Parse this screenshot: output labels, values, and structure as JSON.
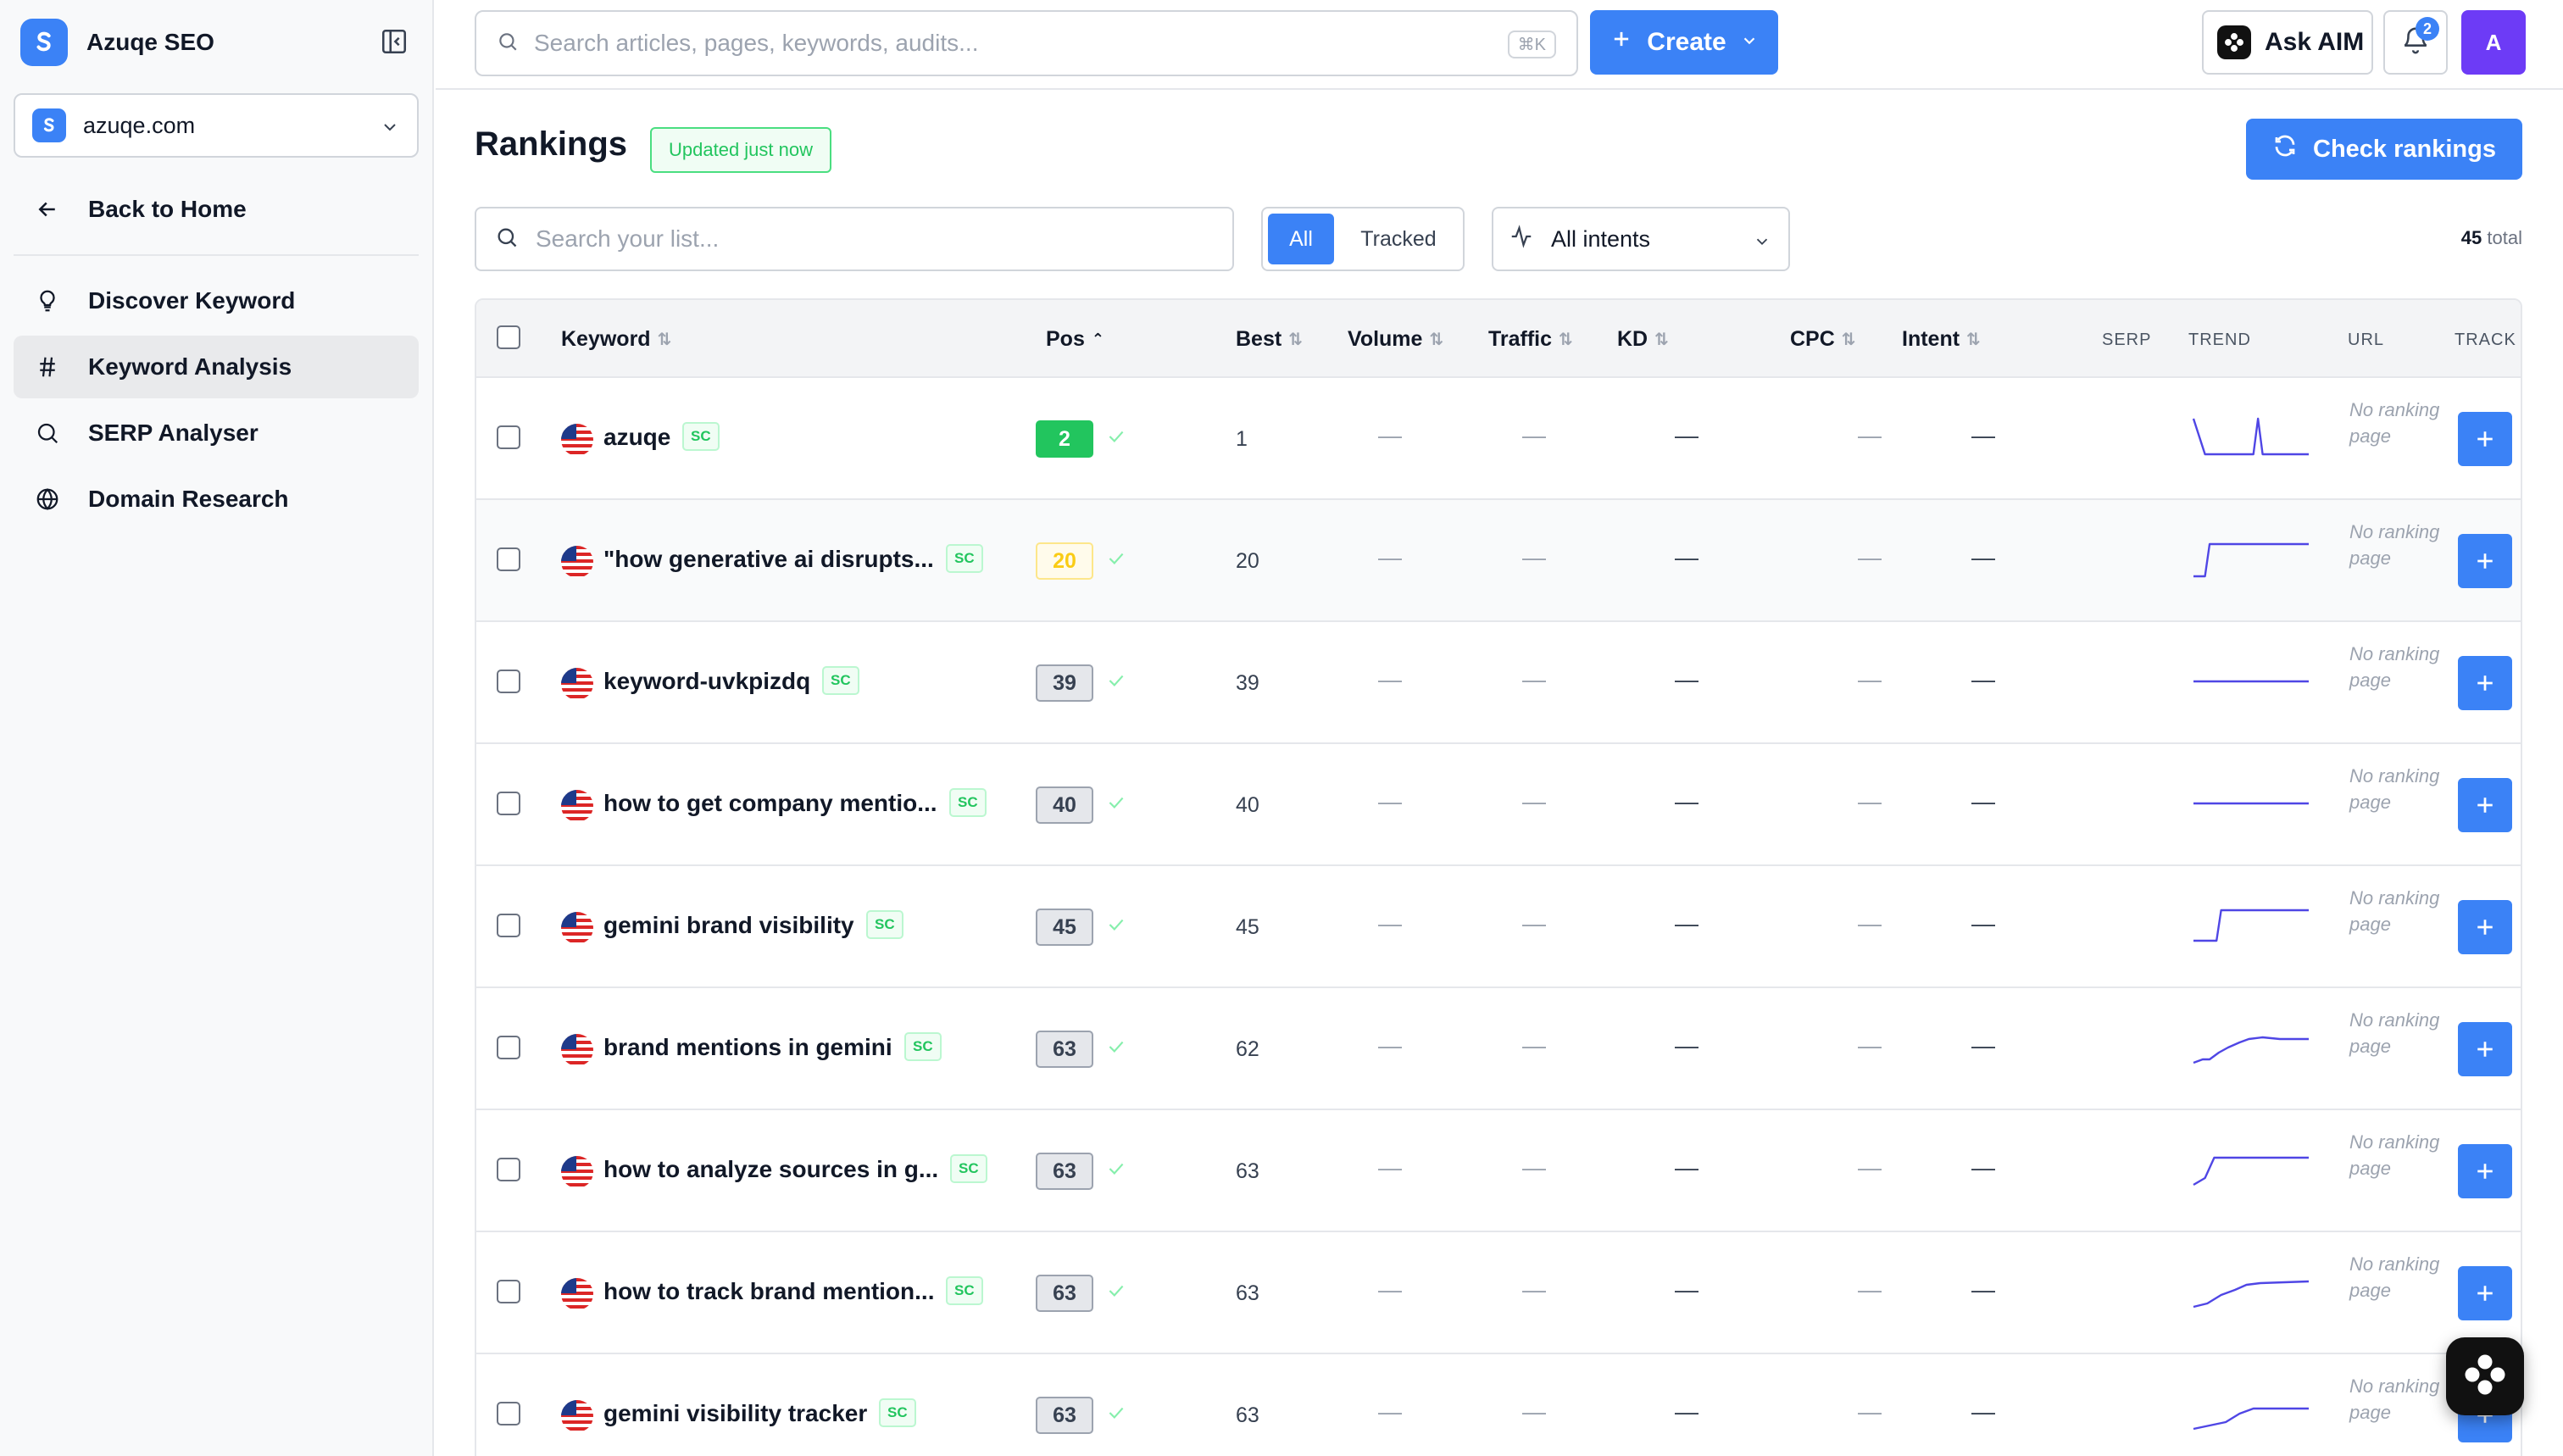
{
  "app": {
    "name": "Azuqe SEO"
  },
  "site_selector": {
    "value": "azuqe.com"
  },
  "nav": {
    "back": "Back to Home",
    "items": [
      {
        "label": "Discover Keyword",
        "icon": "lightbulb-icon"
      },
      {
        "label": "Keyword Analysis",
        "icon": "hash-icon",
        "active": true
      },
      {
        "label": "SERP Analyser",
        "icon": "search-icon"
      },
      {
        "label": "Domain Research",
        "icon": "globe-icon"
      }
    ]
  },
  "topbar": {
    "search_placeholder": "Search articles, pages, keywords, audits...",
    "search_shortcut": "⌘K",
    "create_label": "Create",
    "ask_label": "Ask AIM",
    "notifications_count": "2",
    "avatar_initial": "A"
  },
  "page": {
    "title": "Rankings",
    "updated_badge": "Updated just now",
    "check_button": "Check rankings",
    "list_search_placeholder": "Search your list...",
    "filter_all": "All",
    "filter_tracked": "Tracked",
    "intent_select": "All intents",
    "total_count": "45",
    "total_label": "total"
  },
  "table": {
    "columns": {
      "keyword": "Keyword",
      "pos": "Pos",
      "best": "Best",
      "volume": "Volume",
      "traffic": "Traffic",
      "kd": "KD",
      "cpc": "CPC",
      "intent": "Intent",
      "serp": "SERP",
      "trend": "TREND",
      "url": "URL",
      "track": "TRACK"
    },
    "source_badge": "SC",
    "empty_value": "—",
    "url_empty": "No ranking page",
    "rows": [
      {
        "keyword": "azuqe",
        "pos": "2",
        "pos_style": "green",
        "best": "1",
        "trend": [
          [
            0,
            8
          ],
          [
            10,
            50
          ],
          [
            52,
            50
          ],
          [
            56,
            8
          ],
          [
            60,
            50
          ],
          [
            100,
            50
          ]
        ]
      },
      {
        "keyword": "\"how generative ai disrupts...",
        "pos": "20",
        "pos_style": "yellow",
        "best": "20",
        "trend": [
          [
            0,
            50
          ],
          [
            10,
            50
          ],
          [
            14,
            12
          ],
          [
            100,
            12
          ]
        ]
      },
      {
        "keyword": "keyword-uvkpizdq",
        "pos": "39",
        "pos_style": "gray",
        "best": "39",
        "trend": [
          [
            0,
            30
          ],
          [
            100,
            30
          ]
        ]
      },
      {
        "keyword": "how to get company mentio...",
        "pos": "40",
        "pos_style": "gray",
        "best": "40",
        "trend": [
          [
            0,
            30
          ],
          [
            100,
            30
          ]
        ]
      },
      {
        "keyword": "gemini brand visibility",
        "pos": "45",
        "pos_style": "gray",
        "best": "45",
        "trend": [
          [
            0,
            48
          ],
          [
            20,
            48
          ],
          [
            24,
            12
          ],
          [
            100,
            12
          ]
        ]
      },
      {
        "keyword": "brand mentions in gemini",
        "pos": "63",
        "pos_style": "gray",
        "best": "62",
        "trend": [
          [
            0,
            48
          ],
          [
            8,
            44
          ],
          [
            14,
            44
          ],
          [
            22,
            36
          ],
          [
            30,
            30
          ],
          [
            40,
            24
          ],
          [
            48,
            20
          ],
          [
            60,
            18
          ],
          [
            75,
            20
          ],
          [
            100,
            20
          ]
        ]
      },
      {
        "keyword": "how to analyze sources in g...",
        "pos": "63",
        "pos_style": "gray",
        "best": "63",
        "trend": [
          [
            0,
            48
          ],
          [
            10,
            40
          ],
          [
            18,
            16
          ],
          [
            100,
            16
          ]
        ]
      },
      {
        "keyword": "how to track brand mention...",
        "pos": "63",
        "pos_style": "gray",
        "best": "63",
        "trend": [
          [
            0,
            48
          ],
          [
            12,
            44
          ],
          [
            24,
            34
          ],
          [
            36,
            28
          ],
          [
            46,
            22
          ],
          [
            58,
            20
          ],
          [
            100,
            18
          ]
        ]
      },
      {
        "keyword": "gemini visibility tracker",
        "pos": "63",
        "pos_style": "gray",
        "best": "63",
        "trend": [
          [
            0,
            48
          ],
          [
            14,
            44
          ],
          [
            28,
            40
          ],
          [
            40,
            30
          ],
          [
            52,
            24
          ],
          [
            100,
            24
          ]
        ]
      }
    ]
  },
  "colors": {
    "accent": "#3b82f6",
    "trend_line": "#4f46e5",
    "success": "#22c55e"
  }
}
